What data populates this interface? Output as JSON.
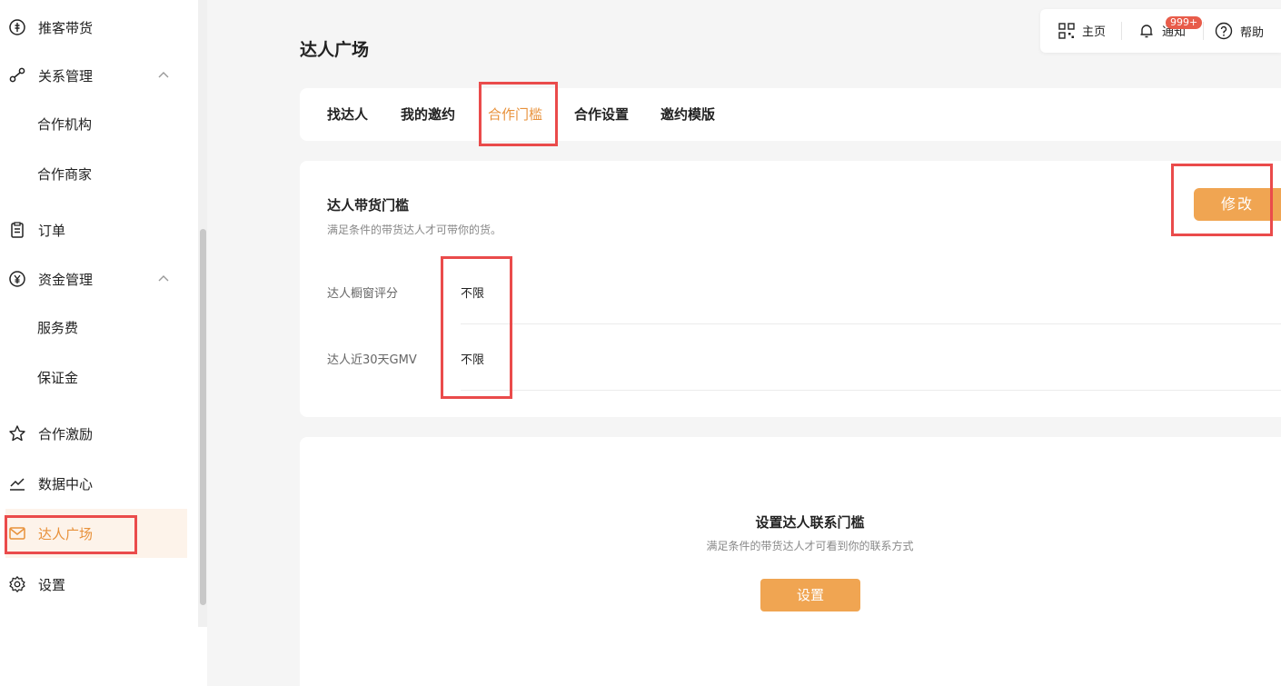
{
  "sidebar": {
    "items": [
      {
        "label": "推客带货",
        "icon": "coin-icon"
      },
      {
        "label": "关系管理",
        "icon": "relation-icon",
        "expanded": true
      },
      {
        "label": "合作机构",
        "sub": true
      },
      {
        "label": "合作商家",
        "sub": true
      },
      {
        "label": "订单",
        "icon": "clipboard-icon"
      },
      {
        "label": "资金管理",
        "icon": "yen-icon",
        "expanded": true
      },
      {
        "label": "服务费",
        "sub": true
      },
      {
        "label": "保证金",
        "sub": true
      },
      {
        "label": "合作激励",
        "icon": "star-icon"
      },
      {
        "label": "数据中心",
        "icon": "chart-line-icon"
      },
      {
        "label": "达人广场",
        "icon": "mail-icon",
        "active": true
      },
      {
        "label": "设置",
        "icon": "gear-icon"
      }
    ]
  },
  "header": {
    "title": "达人广场",
    "home_label": "主页",
    "notify_label": "通知",
    "notify_badge": "999+",
    "help_label": "帮助"
  },
  "tabs": [
    {
      "label": "找达人"
    },
    {
      "label": "我的邀约"
    },
    {
      "label": "合作门槛",
      "active": true
    },
    {
      "label": "合作设置"
    },
    {
      "label": "邀约模版"
    }
  ],
  "threshold": {
    "title": "达人带货门槛",
    "subtitle": "满足条件的带货达人才可带你的货。",
    "edit_label": "修改",
    "rows": [
      {
        "label": "达人橱窗评分",
        "value": "不限"
      },
      {
        "label": "达人近30天GMV",
        "value": "不限"
      }
    ]
  },
  "contact": {
    "title": "设置达人联系门槛",
    "subtitle": "满足条件的带货达人才可看到你的联系方式",
    "button_label": "设置"
  },
  "colors": {
    "accent": "#e8913a",
    "button": "#f0a552",
    "annotation": "#ea4b4b"
  }
}
